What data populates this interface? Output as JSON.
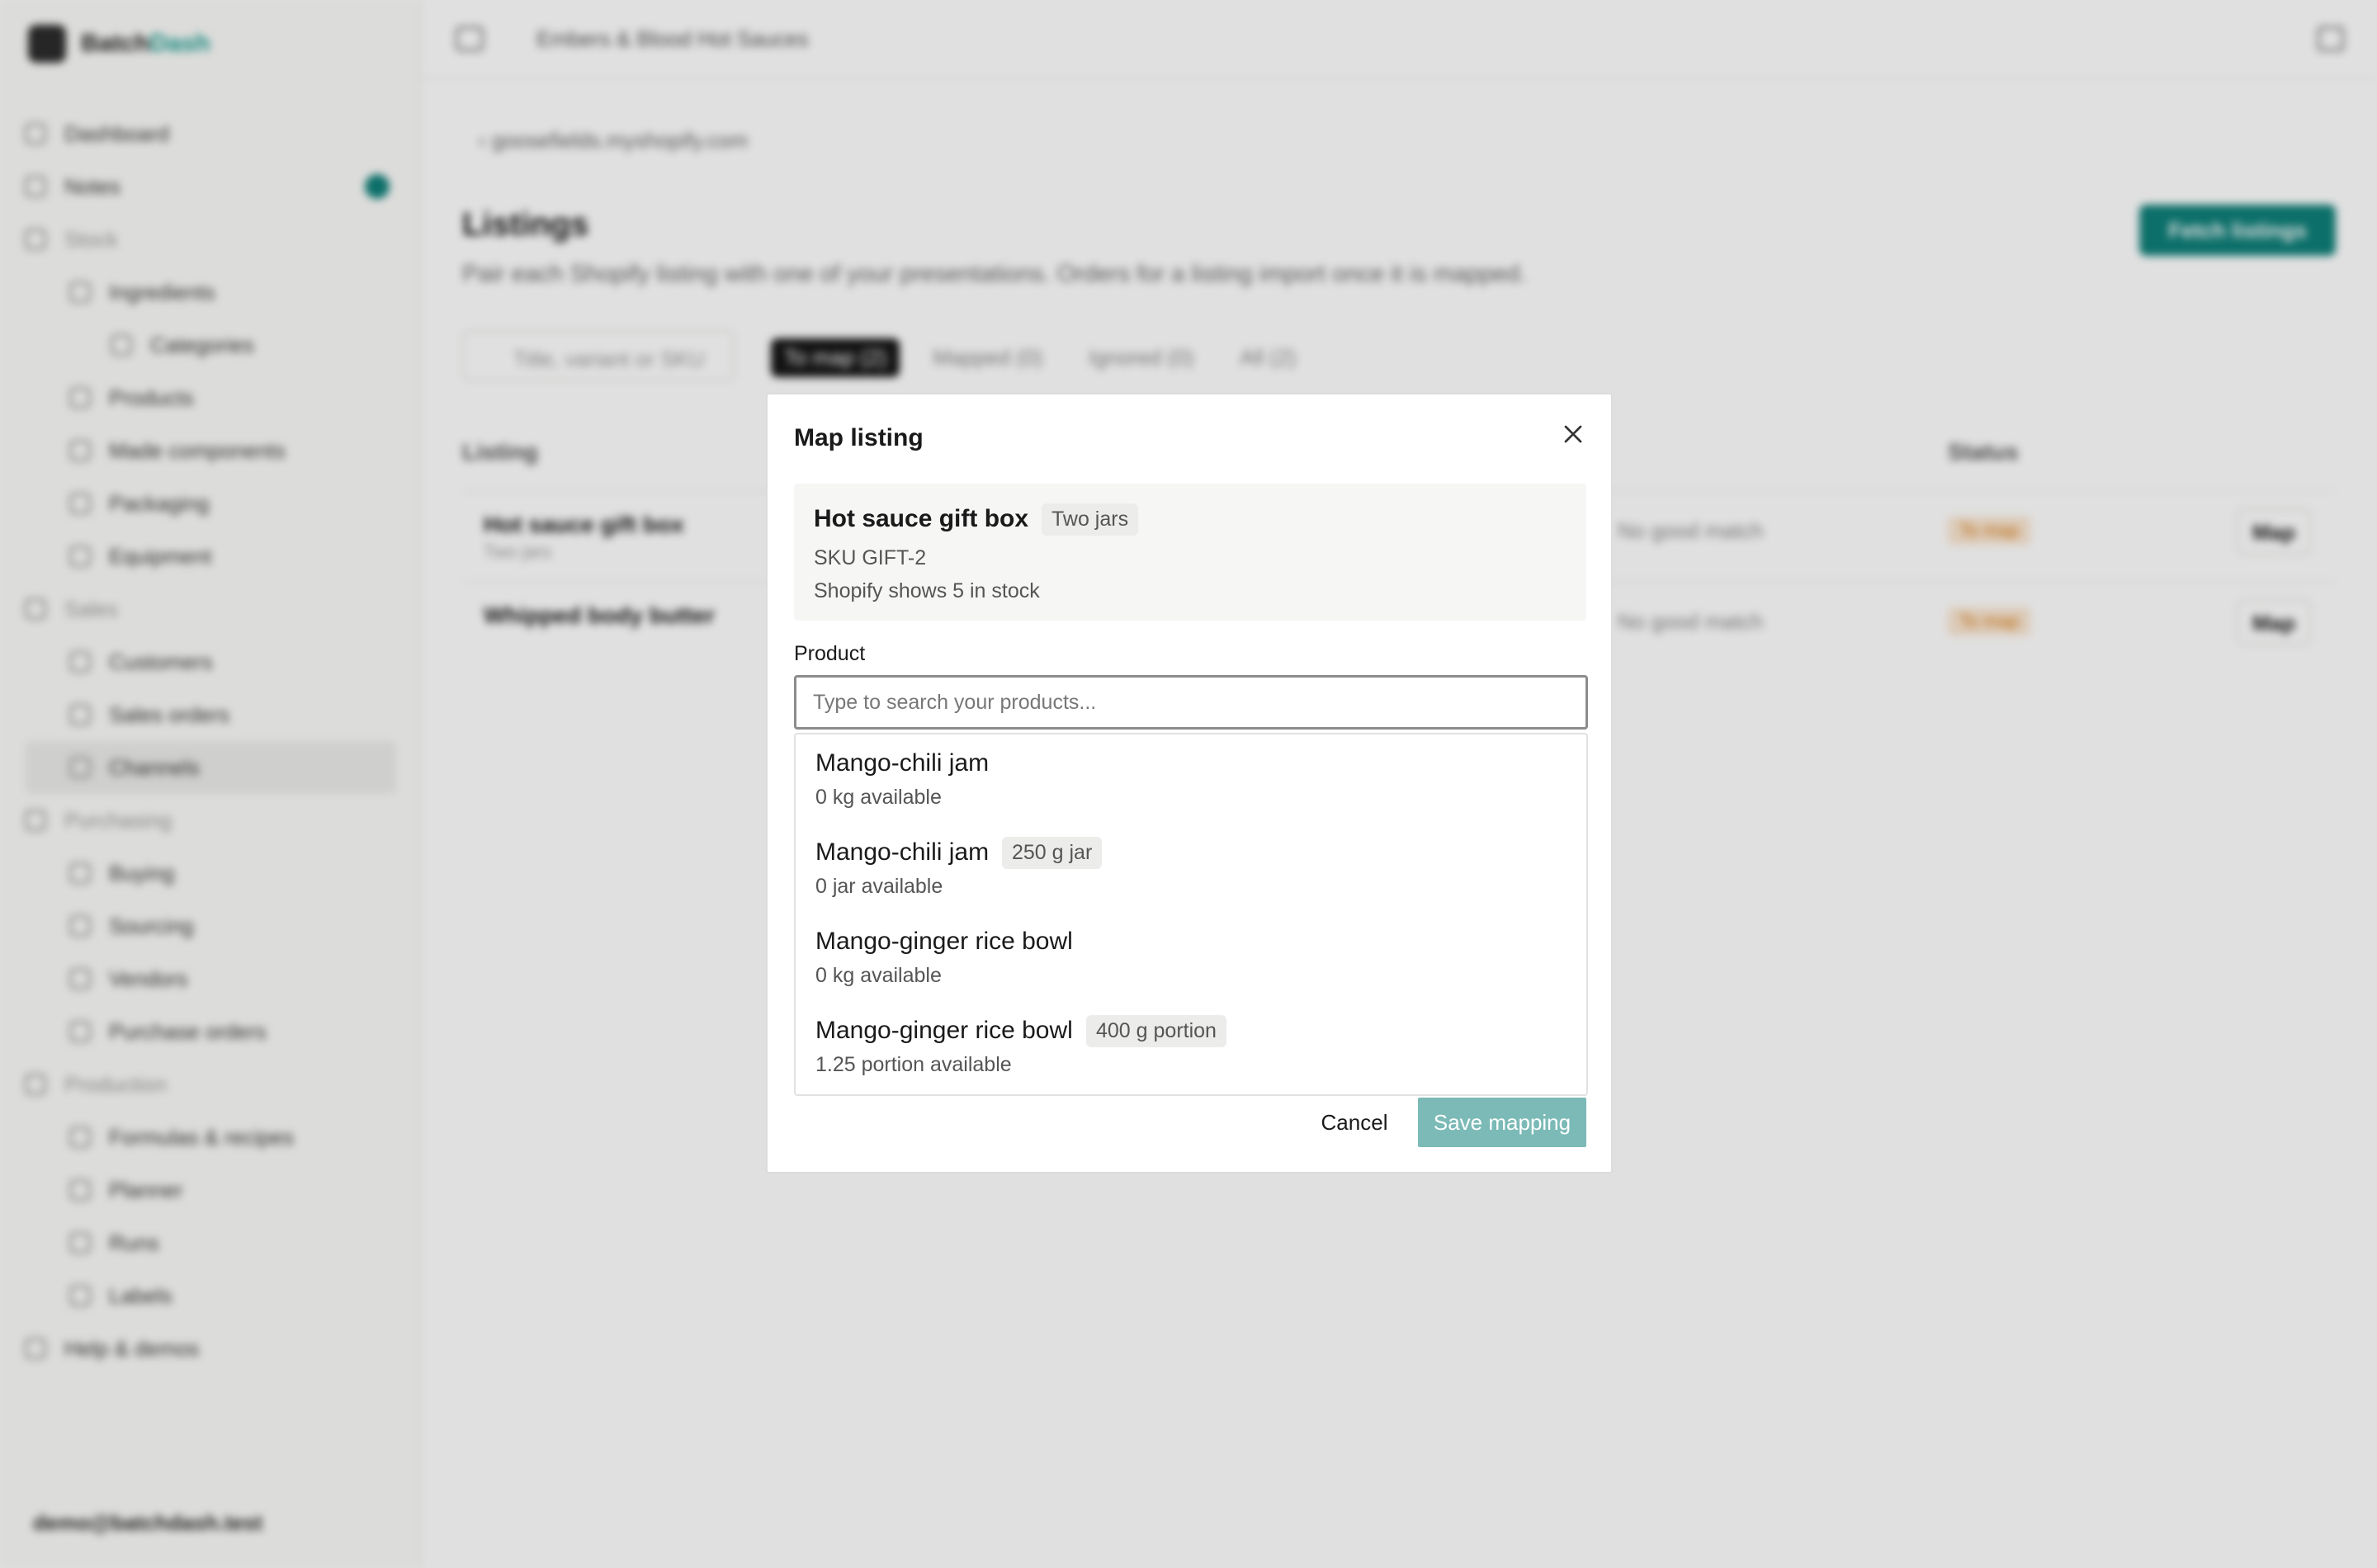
{
  "app": {
    "brand_part1": "Batch",
    "brand_part2": "Dash",
    "org_name": "Embers & Blood Hot Sauces",
    "user_email": "demo@batchdash.test"
  },
  "sidebar": {
    "items": [
      {
        "label": "Dashboard",
        "level": 0
      },
      {
        "label": "Notes",
        "level": 0
      },
      {
        "label": "Stock",
        "level": 0,
        "section": true
      },
      {
        "label": "Ingredients",
        "level": 1
      },
      {
        "label": "Categories",
        "level": 2
      },
      {
        "label": "Products",
        "level": 1
      },
      {
        "label": "Made components",
        "level": 1
      },
      {
        "label": "Packaging",
        "level": 1
      },
      {
        "label": "Equipment",
        "level": 1
      },
      {
        "label": "Sales",
        "level": 0,
        "section": true
      },
      {
        "label": "Customers",
        "level": 1
      },
      {
        "label": "Sales orders",
        "level": 1
      },
      {
        "label": "Channels",
        "level": 1,
        "active": true
      },
      {
        "label": "Purchasing",
        "level": 0,
        "section": true
      },
      {
        "label": "Buying",
        "level": 1
      },
      {
        "label": "Sourcing",
        "level": 1
      },
      {
        "label": "Vendors",
        "level": 1
      },
      {
        "label": "Purchase orders",
        "level": 1
      },
      {
        "label": "Production",
        "level": 0,
        "section": true
      },
      {
        "label": "Formulas & recipes",
        "level": 1
      },
      {
        "label": "Planner",
        "level": 1
      },
      {
        "label": "Runs",
        "level": 1
      },
      {
        "label": "Labels",
        "level": 1
      },
      {
        "label": "Help & demos",
        "level": 0
      }
    ]
  },
  "page": {
    "back_link": "goosefields.myshopify.com",
    "title": "Listings",
    "subtitle": "Pair each Shopify listing with one of your presentations. Orders for a listing import once it is mapped.",
    "fetch_button": "Fetch listings",
    "search_placeholder": "Title, variant or SKU",
    "filters": [
      "To map (2)",
      "Mapped (0)",
      "Ignored (0)",
      "All (2)"
    ],
    "columns": [
      "Listing",
      "Status"
    ],
    "rows": [
      {
        "name": "Hot sauce gift box",
        "sub": "Two jars",
        "match": "No good match",
        "status": "To map",
        "action": "Map"
      },
      {
        "name": "Whipped body butter",
        "sub": "",
        "match": "No good match",
        "status": "To map",
        "action": "Map"
      }
    ]
  },
  "modal": {
    "title": "Map listing",
    "listing": {
      "name": "Hot sauce gift box",
      "variant": "Two jars",
      "sku": "SKU GIFT-2",
      "stock": "Shopify shows 5 in stock"
    },
    "product_label": "Product",
    "product_placeholder": "Type to search your products...",
    "options": [
      {
        "name": "Mango-chili jam",
        "tag": "",
        "available": "0 kg available"
      },
      {
        "name": "Mango-chili jam",
        "tag": "250 g jar",
        "available": "0 jar available"
      },
      {
        "name": "Mango-ginger rice bowl",
        "tag": "",
        "available": "0 kg available"
      },
      {
        "name": "Mango-ginger rice bowl",
        "tag": "400 g portion",
        "available": "1.25 portion available"
      }
    ],
    "cancel_label": "Cancel",
    "save_label": "Save mapping"
  }
}
